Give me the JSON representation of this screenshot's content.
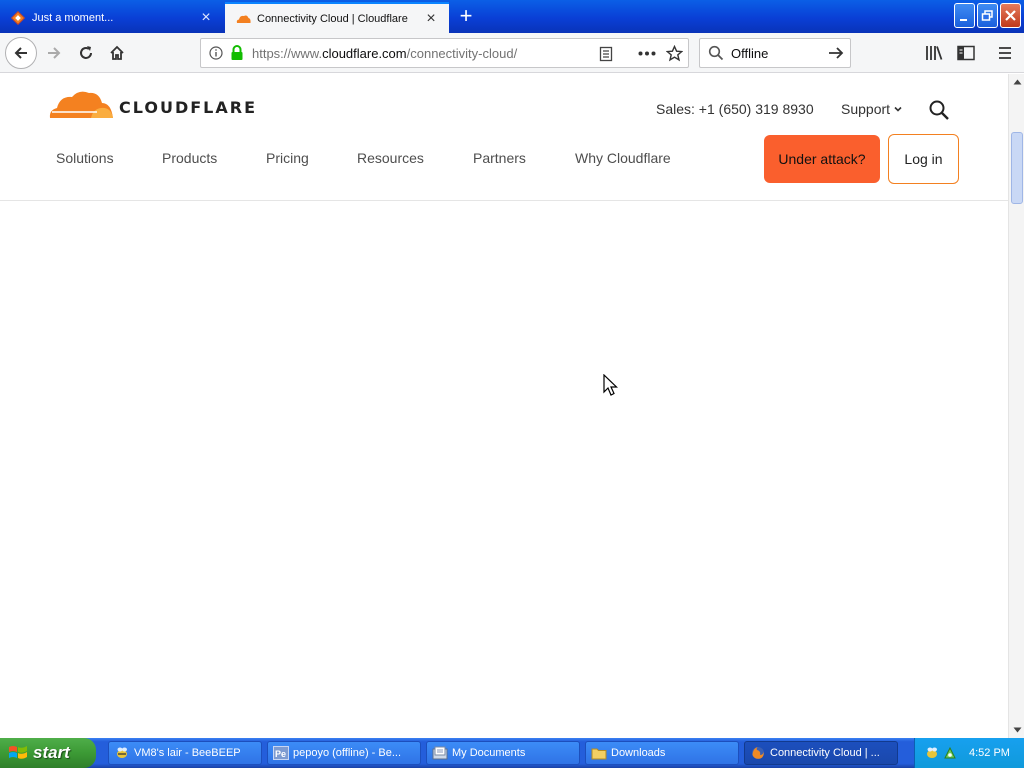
{
  "browser": {
    "tabs": [
      {
        "title": "Just a moment...",
        "active": false
      },
      {
        "title": "Connectivity Cloud | Cloudflare",
        "active": true
      }
    ],
    "url": {
      "prefix": "https://www.",
      "host": "cloudflare.com",
      "path": "/connectivity-cloud/"
    },
    "search_value": "Offline"
  },
  "site": {
    "logo_text": "CLOUDFLARE",
    "sales": "Sales: +1 (650) 319 8930",
    "support": "Support",
    "nav": [
      "Solutions",
      "Products",
      "Pricing",
      "Resources",
      "Partners",
      "Why Cloudflare"
    ],
    "attack_button": "Under attack?",
    "login_button": "Log in"
  },
  "taskbar": {
    "start": "start",
    "tasks": [
      {
        "label": "VM8's lair - BeeBEEP",
        "icon": "beebeep-icon"
      },
      {
        "label": "pepoyo (offline) - Be...",
        "icon": "pe-icon"
      },
      {
        "label": "My Documents",
        "icon": "documents-icon"
      },
      {
        "label": "Downloads",
        "icon": "folder-icon"
      },
      {
        "label": "Connectivity Cloud | ...",
        "icon": "firefox-icon",
        "active": true
      }
    ],
    "clock": "4:52 PM"
  },
  "colors": {
    "accent_orange": "#f38020",
    "attack_button": "#fa5f2d",
    "xp_blue": "#245edb",
    "start_green": "#3c9a35"
  }
}
